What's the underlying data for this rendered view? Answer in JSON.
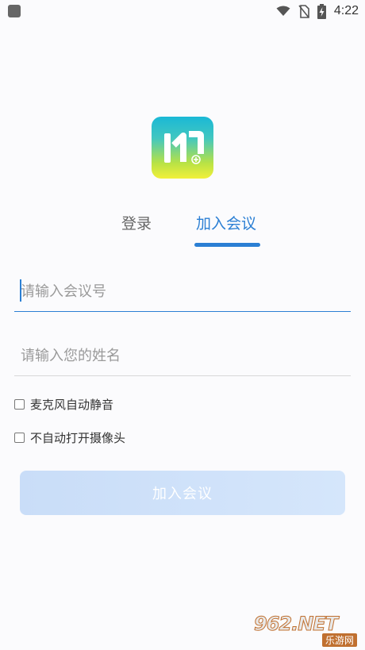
{
  "status_bar": {
    "time": "4:22",
    "icons": [
      "app-notification-icon",
      "wifi-icon",
      "no-sim-icon",
      "battery-charging-icon"
    ]
  },
  "logo": {
    "icon": "meeting-app-logo-icon"
  },
  "tabs": {
    "login_label": "登录",
    "join_label": "加入会议",
    "active": "join"
  },
  "form": {
    "meeting_id_placeholder": "请输入会议号",
    "meeting_id_value": "",
    "name_placeholder": "请输入您的姓名",
    "name_value": "",
    "options": {
      "mute_mic_label": "麦克风自动静音",
      "mute_mic_checked": false,
      "camera_off_label": "不自动打开摄像头",
      "camera_off_checked": false
    },
    "join_button_label": "加入会议"
  },
  "watermark": {
    "main": "962.NET",
    "sub": "乐游网"
  },
  "colors": {
    "accent": "#2b7fd4",
    "button_bg": "#cfe1fa",
    "background": "#fbfbfd"
  }
}
